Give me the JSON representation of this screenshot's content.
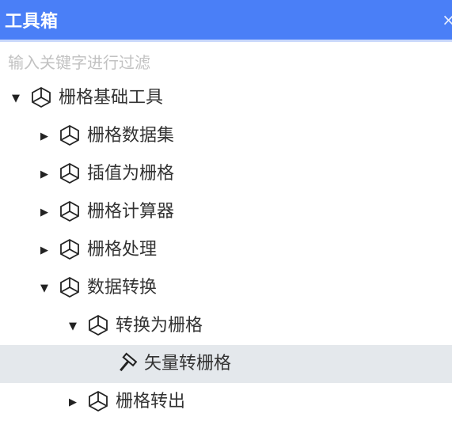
{
  "window": {
    "title": "工具箱",
    "close_label": "×"
  },
  "search": {
    "placeholder": "输入关键字进行过滤",
    "value": ""
  },
  "colors": {
    "titlebar": "#4a7ff7",
    "selected_row": "#e4e8ec",
    "text": "#333333"
  },
  "tree": [
    {
      "label": "栅格基础工具",
      "state": "expanded",
      "icon": "cube-icon"
    },
    {
      "label": "栅格数据集",
      "state": "collapsed",
      "icon": "cube-icon"
    },
    {
      "label": "插值为栅格",
      "state": "collapsed",
      "icon": "cube-icon"
    },
    {
      "label": "栅格计算器",
      "state": "collapsed",
      "icon": "cube-icon"
    },
    {
      "label": "栅格处理",
      "state": "collapsed",
      "icon": "cube-icon"
    },
    {
      "label": "数据转换",
      "state": "expanded",
      "icon": "cube-icon"
    },
    {
      "label": "转换为栅格",
      "state": "expanded",
      "icon": "cube-icon"
    },
    {
      "label": "矢量转栅格",
      "state": "leaf",
      "icon": "hammer-icon",
      "selected": true
    },
    {
      "label": "栅格转出",
      "state": "collapsed",
      "icon": "cube-icon"
    }
  ]
}
